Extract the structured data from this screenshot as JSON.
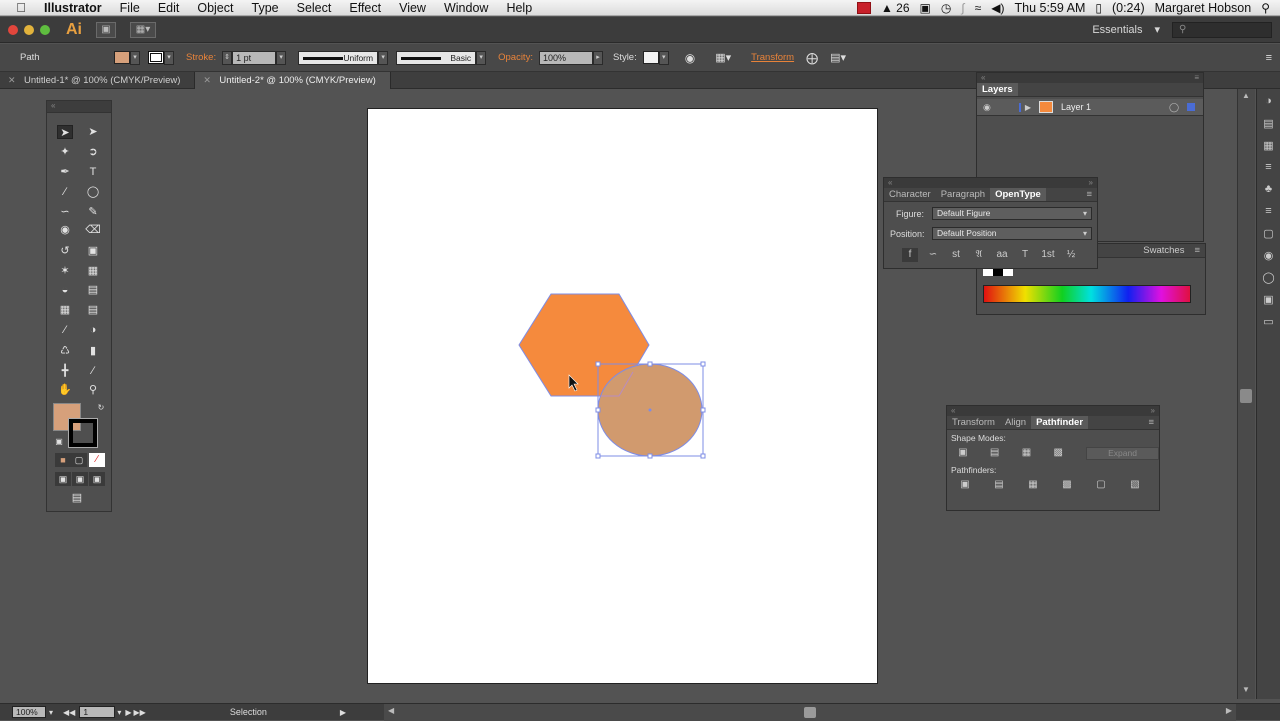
{
  "menubar": {
    "apple": "",
    "app_name": "Illustrator",
    "items": [
      "File",
      "Edit",
      "Object",
      "Type",
      "Select",
      "Effect",
      "View",
      "Window",
      "Help"
    ],
    "adobe_count": "26",
    "time": "Thu 5:59 AM",
    "battery": "(0:24)",
    "user": "Margaret Hobson"
  },
  "appbar": {
    "logo": "Ai",
    "workspace": "Essentials",
    "search_placeholder": ""
  },
  "control": {
    "selection_type": "Path",
    "stroke_label": "Stroke:",
    "stroke_value": "1 pt",
    "profile_label": "Uniform",
    "brush_label": "Basic",
    "opacity_label": "Opacity:",
    "opacity_value": "100%",
    "style_label": "Style:",
    "transform_label": "Transform",
    "fill_color": "#d6a07b"
  },
  "tabs": [
    {
      "label": "Untitled-1* @ 100% (CMYK/Preview)"
    },
    {
      "label": "Untitled-2* @ 100% (CMYK/Preview)"
    }
  ],
  "layers_panel": {
    "title": "Layers",
    "layer_name": "Layer 1"
  },
  "swatches_panel": {
    "label": "Swatches"
  },
  "opentype_panel": {
    "tabs": [
      "Character",
      "Paragraph",
      "OpenType"
    ],
    "figure_label": "Figure:",
    "figure_value": "Default Figure",
    "position_label": "Position:",
    "position_value": "Default Position"
  },
  "pathfinder_panel": {
    "tabs": [
      "Transform",
      "Align",
      "Pathfinder"
    ],
    "shape_modes_label": "Shape Modes:",
    "expand_label": "Expand",
    "pathfinders_label": "Pathfinders:"
  },
  "canvas": {
    "hexagon_color": "#f58a3d",
    "circle_color": "#d19a6e",
    "selection_color": "#7d8ce6"
  },
  "status": {
    "zoom": "100%",
    "artboard": "1",
    "tool": "Selection"
  }
}
